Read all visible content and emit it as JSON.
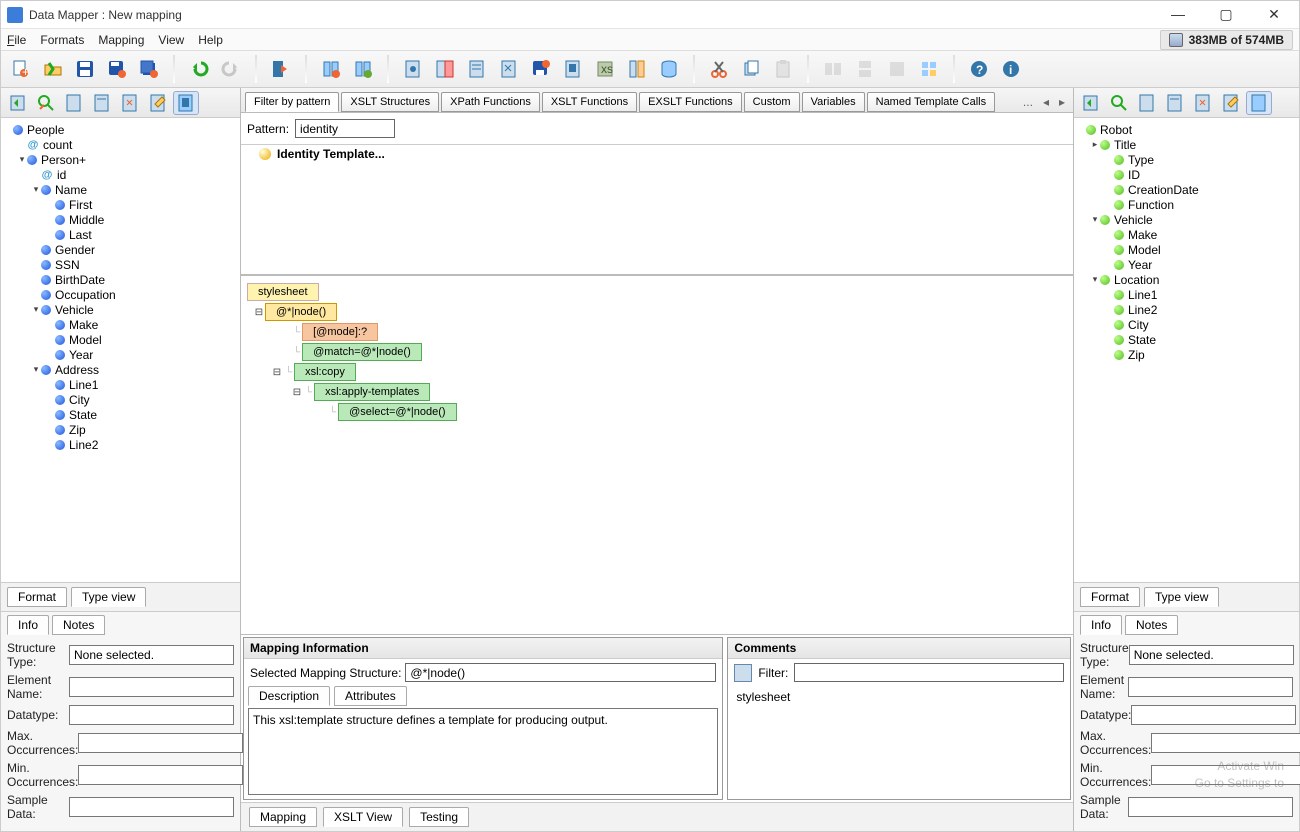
{
  "window": {
    "title": "Data Mapper : New mapping"
  },
  "menu": {
    "file": "File",
    "formats": "Formats",
    "mapping": "Mapping",
    "view": "View",
    "help": "Help"
  },
  "memory": "383MB of 574MB",
  "left_tree": [
    {
      "d": 0,
      "t": "blue",
      "lbl": "People",
      "tg": ""
    },
    {
      "d": 1,
      "t": "at",
      "lbl": "count",
      "tg": ""
    },
    {
      "d": 1,
      "t": "blue",
      "lbl": "Person+",
      "tg": "▾"
    },
    {
      "d": 2,
      "t": "at",
      "lbl": "id",
      "tg": ""
    },
    {
      "d": 2,
      "t": "blue",
      "lbl": "Name",
      "tg": "▾"
    },
    {
      "d": 3,
      "t": "blue",
      "lbl": "First",
      "tg": ""
    },
    {
      "d": 3,
      "t": "blue",
      "lbl": "Middle",
      "tg": ""
    },
    {
      "d": 3,
      "t": "blue",
      "lbl": "Last",
      "tg": ""
    },
    {
      "d": 2,
      "t": "blue",
      "lbl": "Gender",
      "tg": ""
    },
    {
      "d": 2,
      "t": "blue",
      "lbl": "SSN",
      "tg": ""
    },
    {
      "d": 2,
      "t": "blue",
      "lbl": "BirthDate",
      "tg": ""
    },
    {
      "d": 2,
      "t": "blue",
      "lbl": "Occupation",
      "tg": ""
    },
    {
      "d": 2,
      "t": "blue",
      "lbl": "Vehicle",
      "tg": "▾"
    },
    {
      "d": 3,
      "t": "blue",
      "lbl": "Make",
      "tg": ""
    },
    {
      "d": 3,
      "t": "blue",
      "lbl": "Model",
      "tg": ""
    },
    {
      "d": 3,
      "t": "blue",
      "lbl": "Year",
      "tg": ""
    },
    {
      "d": 2,
      "t": "blue",
      "lbl": "Address",
      "tg": "▾"
    },
    {
      "d": 3,
      "t": "blue",
      "lbl": "Line1",
      "tg": ""
    },
    {
      "d": 3,
      "t": "blue",
      "lbl": "City",
      "tg": ""
    },
    {
      "d": 3,
      "t": "blue",
      "lbl": "State",
      "tg": ""
    },
    {
      "d": 3,
      "t": "blue",
      "lbl": "Zip",
      "tg": ""
    },
    {
      "d": 3,
      "t": "blue",
      "lbl": "Line2",
      "tg": ""
    }
  ],
  "right_tree": [
    {
      "d": 0,
      "t": "green",
      "lbl": "Robot",
      "tg": ""
    },
    {
      "d": 1,
      "t": "green",
      "lbl": "Title",
      "tg": "▸"
    },
    {
      "d": 2,
      "t": "green",
      "lbl": "Type",
      "tg": ""
    },
    {
      "d": 2,
      "t": "green",
      "lbl": "ID",
      "tg": ""
    },
    {
      "d": 2,
      "t": "green",
      "lbl": "CreationDate",
      "tg": ""
    },
    {
      "d": 2,
      "t": "green",
      "lbl": "Function",
      "tg": ""
    },
    {
      "d": 1,
      "t": "green",
      "lbl": "Vehicle",
      "tg": "▾"
    },
    {
      "d": 2,
      "t": "green",
      "lbl": "Make",
      "tg": ""
    },
    {
      "d": 2,
      "t": "green",
      "lbl": "Model",
      "tg": ""
    },
    {
      "d": 2,
      "t": "green",
      "lbl": "Year",
      "tg": ""
    },
    {
      "d": 1,
      "t": "green",
      "lbl": "Location",
      "tg": "▾"
    },
    {
      "d": 2,
      "t": "green",
      "lbl": "Line1",
      "tg": ""
    },
    {
      "d": 2,
      "t": "green",
      "lbl": "Line2",
      "tg": ""
    },
    {
      "d": 2,
      "t": "green",
      "lbl": "City",
      "tg": ""
    },
    {
      "d": 2,
      "t": "green",
      "lbl": "State",
      "tg": ""
    },
    {
      "d": 2,
      "t": "green",
      "lbl": "Zip",
      "tg": ""
    }
  ],
  "center_tabs": [
    "Filter by pattern",
    "XSLT Structures",
    "XPath Functions",
    "XSLT Functions",
    "EXSLT Functions",
    "Custom",
    "Variables",
    "Named Template Calls"
  ],
  "center_more": "...",
  "pattern": {
    "label": "Pattern:",
    "value": "identity",
    "result": "Identity Template..."
  },
  "xslt_nodes": {
    "stylesheet": "stylesheet",
    "root": "@*|node()",
    "mode": "[@mode]:?",
    "match": "@match=@*|node()",
    "copy": "xsl:copy",
    "apply": "xsl:apply-templates",
    "select": "@select=@*|node()"
  },
  "side_tabs": {
    "format": "Format",
    "typeview": "Type view"
  },
  "info_tabs": {
    "info": "Info",
    "notes": "Notes"
  },
  "info_form": {
    "structure_type_label": "Structure Type:",
    "structure_type_value": "None selected.",
    "element_name_label": "Element Name:",
    "element_name_value": "",
    "datatype_label": "Datatype:",
    "datatype_value": "",
    "max_occ_label": "Max. Occurrences:",
    "max_occ_value": "",
    "min_occ_label": "Min. Occurrences:",
    "min_occ_value": "",
    "sample_label": "Sample Data:",
    "sample_value": ""
  },
  "map_info": {
    "title": "Mapping Information",
    "sel_label": "Selected Mapping Structure:",
    "sel_value": "@*|node()",
    "desc_tab": "Description",
    "attr_tab": "Attributes",
    "desc_text": "This xsl:template structure defines a template for producing output."
  },
  "comments": {
    "title": "Comments",
    "filter_label": "Filter:",
    "item": "stylesheet"
  },
  "bottom_tabs": {
    "mapping": "Mapping",
    "xslt": "XSLT View",
    "testing": "Testing"
  },
  "watermark": {
    "line1": "Activate Win",
    "line2": "Go to Settings to"
  }
}
